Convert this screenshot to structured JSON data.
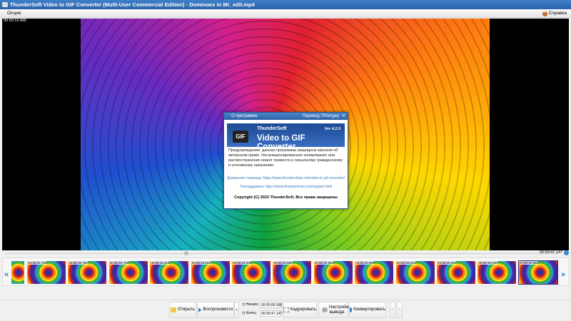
{
  "window": {
    "title": "ThunderSoft Video to GIF Converter (Multi-User Commercial Edition) - Dominoes in 8K_edit.mp4"
  },
  "menu": {
    "options": "Опции",
    "help": "Справка"
  },
  "player": {
    "current_time": "00:00:15.965",
    "total_time": "00:00:47.147",
    "seek_fraction": 0.338
  },
  "thumbnails": [
    "",
    "00:00:15.765",
    "00:00:15.782",
    "00:00:15.799",
    "00:00:15.815",
    "00:00:15.832",
    "00:00:15.849",
    "00:00:15.865",
    "00:00:15.882",
    "00:00:15.899",
    "00:00:15.915",
    "00:00:15.932",
    "00:00:15.949",
    "00:00:15.965"
  ],
  "toolbar": {
    "open": "Открыть",
    "play": "Воспроизвести",
    "start_label": "Начало",
    "start_value": "00:00:00.000",
    "end_label": "Конец",
    "end_value": "00:00:47.147",
    "crop": "Кадрировать",
    "output_settings": "Настройки вывода",
    "convert": "Конвертировать"
  },
  "about": {
    "title": "О программе",
    "translation": "Перевод:78Sergey",
    "brand": "ThunderSoft",
    "product": "Video to GIF Converter",
    "version": "Ver 4.2.0",
    "logo_text": "GIF",
    "warning": "Предупреждение: данная программа защищена законом об авторском праве. Несанкционированное копирование или распространение может привести к серьезному гражданскому и уголовному наказанию.",
    "homepage": "Домашняя страница: https://www.thundershare.net/video-to-gif-converter/",
    "support": "Техподдержка: https://www.thundershare.net/support.html",
    "copyright": "Copyright (C) 2023 ThunderSoft, Все права защищены"
  }
}
